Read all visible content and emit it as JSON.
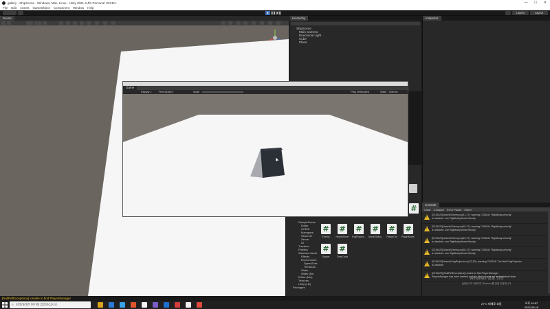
{
  "window": {
    "title": "gallery - ShipScene - Windows, Mac, Linux - Unity 2021.3.4f1 Personal <DX11>",
    "minimize_glyph": "—",
    "maximize_glyph": "☐",
    "close_glyph": "✕"
  },
  "menu": [
    "File",
    "Edit",
    "Assets",
    "GameObject",
    "Component",
    "Window",
    "Help"
  ],
  "toolbar": {
    "play_glyph": "▶",
    "pause_glyph": "❚❚",
    "step_glyph": "▶❚",
    "layers_label": "Layers",
    "layout_label": "Layout",
    "accent_color": "#3d6fb5"
  },
  "scene": {
    "tab_label": "Scene",
    "ground_color": "#f6f6f6",
    "horizon_color": "#6a655f"
  },
  "hierarchy": {
    "tab_label": "Hierarchy",
    "root": "ShipScene",
    "items": [
      "Main Camera",
      "Directional Light",
      "Cube",
      "Plane"
    ]
  },
  "inspector": {
    "tab_label": "Inspector"
  },
  "game": {
    "tab_label": "Game",
    "display_dropdown": "Display 1",
    "aspect_dropdown": "Free Aspect",
    "scale_label": "Scale",
    "play_mode_dropdown": "Play Unfocused",
    "stats_label": "Stats",
    "gizmos_label": "Gizmos",
    "sky_color": "#7b7570",
    "cube_color": "#2b2f36"
  },
  "project": {
    "tree": [
      "SampleScene",
      "Editor",
      "CCDIK",
      "Managers",
      "Observer",
      "Server",
      "UI",
      "Trackers",
      "Prefabs",
      "Standard Asset",
      "Effects",
      "Environment",
      "SpeedTree",
      "TerrainAs",
      "Water",
      "Water (Ba",
      "Editor (Mis)",
      "Textures",
      "Unity (Lib)",
      "Packages"
    ],
    "assets": [
      {
        "name": "Enemy",
        "glyph": "#"
      },
      {
        "name": "HealthTimer",
        "glyph": "#"
      },
      {
        "name": "FogProject...",
        "glyph": "#"
      },
      {
        "name": "MoveToMou...",
        "glyph": "#"
      },
      {
        "name": "PlayerCtrl",
        "glyph": "#"
      },
      {
        "name": "PlayerMove...",
        "glyph": "#"
      },
      {
        "name": "Spawn",
        "glyph": "#"
      },
      {
        "name": "TimeCycle",
        "glyph": "#"
      }
    ],
    "side_asset_glyph": "#"
  },
  "console": {
    "tab_label": "Console",
    "clear_label": "Clear",
    "collapse_label": "Collapse",
    "error_pause_label": "Error Pause",
    "editor_label": "Editor",
    "warn_glyph": "!",
    "entries": [
      {
        "line1": "[22:56:20] Assets\\Enemy.cs(41,17): warning CS0618: 'Rigidbody.velocity'",
        "line2": "is obsolete: use Rigidbody.linearVelocity"
      },
      {
        "line1": "[22:56:20] Assets\\Enemy.cs(40,17): warning CS0618: 'Rigidbody.velocity'",
        "line2": "is obsolete: use Rigidbody.linearVelocity"
      },
      {
        "line1": "[22:56:20] Assets\\Enemy.cs(39,17): warning CS0618: 'Rigidbody.velocity'",
        "line2": "is obsolete: use Rigidbody.linearVelocity"
      },
      {
        "line1": "[22:56:20] Assets\\Enemy.cs(38,17): warning CS0618: 'Rigidbody.velocity'",
        "line2": "is obsolete: use Rigidbody.linearVelocity"
      },
      {
        "line1": "[22:56:20] Assets\\FogProjector.cs(22,50): warning CS0618: The field FogProjector",
        "line2": "is obsolete"
      },
      {
        "line1": "[22:56:20] [NullRefExceptions] Unable to find PlayerManager",
        "line2": "PlayerManager has been deleted and the Hierarchy is not in the default state"
      }
    ]
  },
  "status": {
    "message": "[NullRefExceptions] Unable to find PlayerManager"
  },
  "taskbar": {
    "search_placeholder": "검색하려면 여기에 입력하십시오.",
    "weather": "27°C 대체로 흐림",
    "time": "오후 10:57",
    "date": "2022-08-18",
    "app_colors": [
      "#d9a21b",
      "#2b7bd6",
      "#3aa0e8",
      "#e0542c",
      "#f2f2f2",
      "#7a5cc8",
      "#1e6fd0",
      "#d23c3c",
      "#f2f2f2",
      "#e04a3c"
    ]
  },
  "watermark": {
    "line1": "Windows 정품 인증",
    "line2": "[설정]으로 이동하여 Windows를 정품 인증합니다."
  }
}
